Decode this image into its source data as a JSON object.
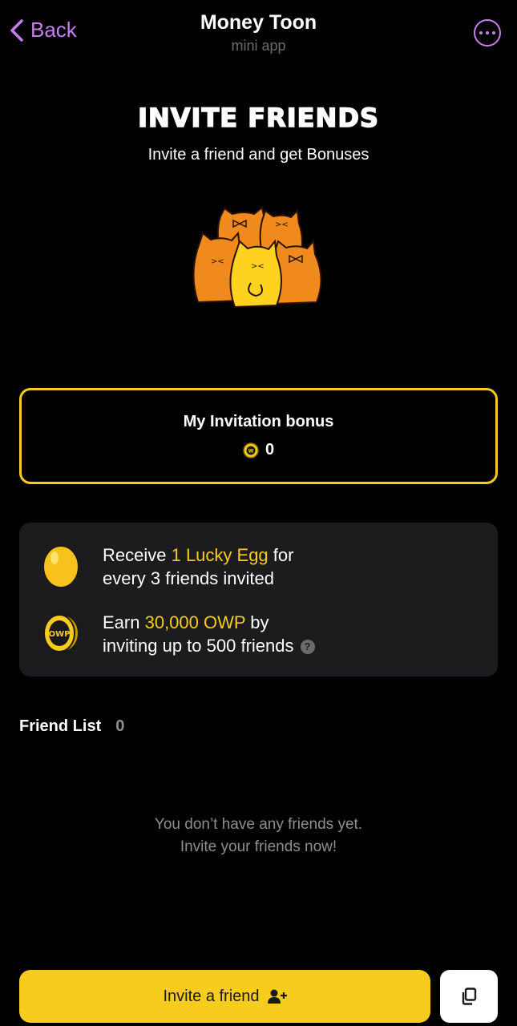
{
  "header": {
    "back_label": "Back",
    "title": "Money Toon",
    "subtitle": "mini app",
    "more_icon": "more-icon"
  },
  "hero": {
    "title": "INVITE FRIENDS",
    "subtitle": "Invite a friend and get Bonuses"
  },
  "bonus": {
    "title": "My Invitation bonus",
    "value": "0"
  },
  "rewards": {
    "egg": {
      "prefix": "Receive ",
      "highlight": "1 Lucky Egg",
      "suffix": " for",
      "line2": "every 3 friends invited"
    },
    "owp": {
      "prefix": "Earn ",
      "highlight": "30,000 OWP",
      "suffix": " by",
      "line2": "inviting up to 500 friends",
      "help": "?"
    }
  },
  "friends": {
    "title": "Friend List",
    "count": "0",
    "empty_line1": "You don’t have any friends yet.",
    "empty_line2": "Invite your friends now!"
  },
  "actions": {
    "invite_label": "Invite a friend"
  },
  "colors": {
    "accent": "#f7cc1e",
    "purple": "#c77ef0",
    "background": "#000000",
    "card": "#1c1c1e"
  }
}
